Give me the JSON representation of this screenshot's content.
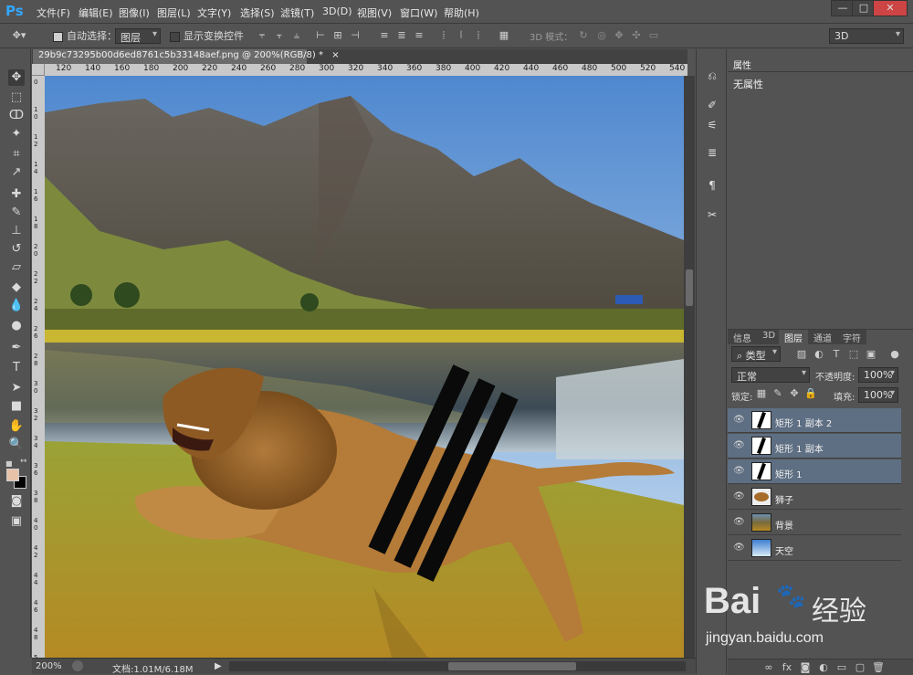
{
  "app": {
    "logo": "Ps",
    "menus": [
      "文件(F)",
      "编辑(E)",
      "图像(I)",
      "图层(L)",
      "文字(Y)",
      "选择(S)",
      "滤镜(T)",
      "3D(D)",
      "视图(V)",
      "窗口(W)",
      "帮助(H)"
    ],
    "window_buttons": [
      "—",
      "□",
      "✕"
    ]
  },
  "options_bar": {
    "auto_select_label": "自动选择：",
    "auto_select_checked": true,
    "auto_select_target": "图层",
    "show_transform_label": "显示变换控件",
    "show_transform_checked": false,
    "mode_3d_label": "3D 模式：",
    "workspace": "3D"
  },
  "document": {
    "tab_title": "29b9c73295b00d6ed8761c5b33148aef.png @ 200%(RGB/8) *",
    "tab_close": "×",
    "ruler_ticks": [
      "120",
      "140",
      "160",
      "180",
      "200",
      "220",
      "240",
      "260",
      "280",
      "300",
      "320",
      "340",
      "360",
      "380",
      "400",
      "420",
      "440",
      "460",
      "480",
      "500",
      "520",
      "540"
    ],
    "vruler_ticks": [
      "0",
      "1 0",
      "1 2",
      "1 4",
      "1 6",
      "1 8",
      "2 0",
      "2 2",
      "2 4",
      "2 6",
      "2 8",
      "3 0",
      "3 2",
      "3 4",
      "3 6",
      "3 8",
      "4 0",
      "4 2",
      "4 4",
      "4 6",
      "4 8",
      "5 0"
    ]
  },
  "status": {
    "zoom": "200%",
    "doc_info": "文档:1.01M/6.18M",
    "arrow": "▶"
  },
  "properties_panel": {
    "tab": "属性",
    "content": "无属性"
  },
  "layers_panel": {
    "tabs": [
      "信息",
      "3D",
      "图层",
      "通道",
      "字符"
    ],
    "active_tab": "图层",
    "filter": "类型",
    "blend_mode": "正常",
    "opacity_label": "不透明度:",
    "opacity": "100%",
    "lock_label": "锁定:",
    "fill_label": "填充:",
    "fill": "100%",
    "layers": [
      {
        "name": "矩形 1 副本 2",
        "selected": true,
        "thumb": "shape"
      },
      {
        "name": "矩形 1 副本",
        "selected": true,
        "thumb": "shape"
      },
      {
        "name": "矩形 1",
        "selected": true,
        "thumb": "shape"
      },
      {
        "name": "狮子",
        "selected": false,
        "thumb": "lion"
      },
      {
        "name": "背景",
        "selected": false,
        "thumb": "landscape"
      },
      {
        "name": "天空",
        "selected": false,
        "thumb": "sky"
      }
    ],
    "bottom_icons": [
      "link-icon",
      "fx-icon",
      "mask-icon",
      "adjustment-icon",
      "folder-icon",
      "new-layer-icon",
      "trash-icon"
    ]
  },
  "watermark": {
    "brand": "Bai",
    "brand2": "经验",
    "url": "jingyan.baidu.com"
  }
}
